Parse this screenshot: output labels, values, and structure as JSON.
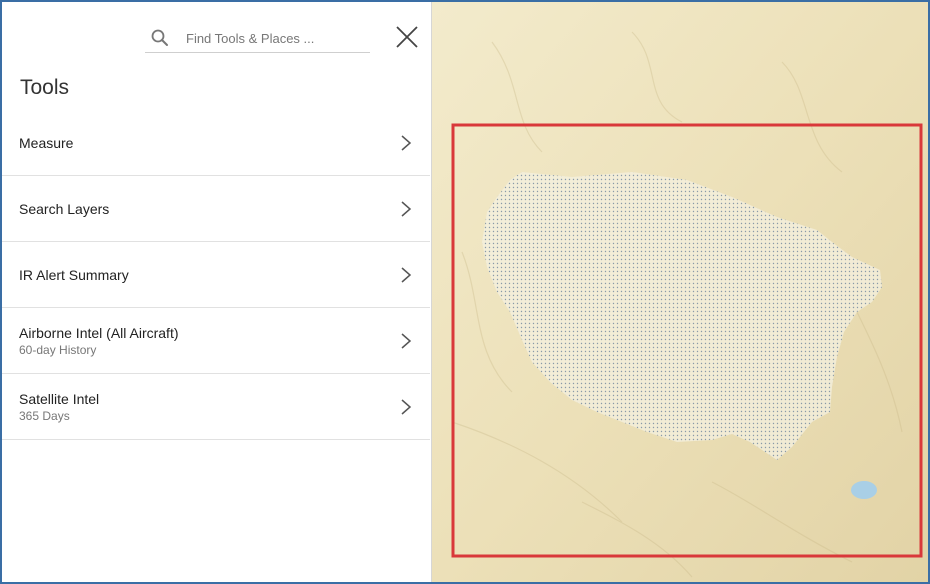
{
  "search": {
    "placeholder": "Find Tools & Places ...",
    "value": ""
  },
  "panel": {
    "title": "Tools"
  },
  "tools": [
    {
      "name": "Measure",
      "sub": ""
    },
    {
      "name": "Search Layers",
      "sub": ""
    },
    {
      "name": "IR Alert Summary",
      "sub": ""
    },
    {
      "name": "Airborne Intel (All Aircraft)",
      "sub": "60-day History"
    },
    {
      "name": "Satellite Intel",
      "sub": "365 Days"
    }
  ],
  "icons": {
    "search": "search-icon",
    "close": "close-icon",
    "chevron": "chevron-right-icon"
  },
  "colors": {
    "selection": "#d9383a",
    "map_base": "#f0e6c4",
    "frame": "#3a6ea5"
  }
}
